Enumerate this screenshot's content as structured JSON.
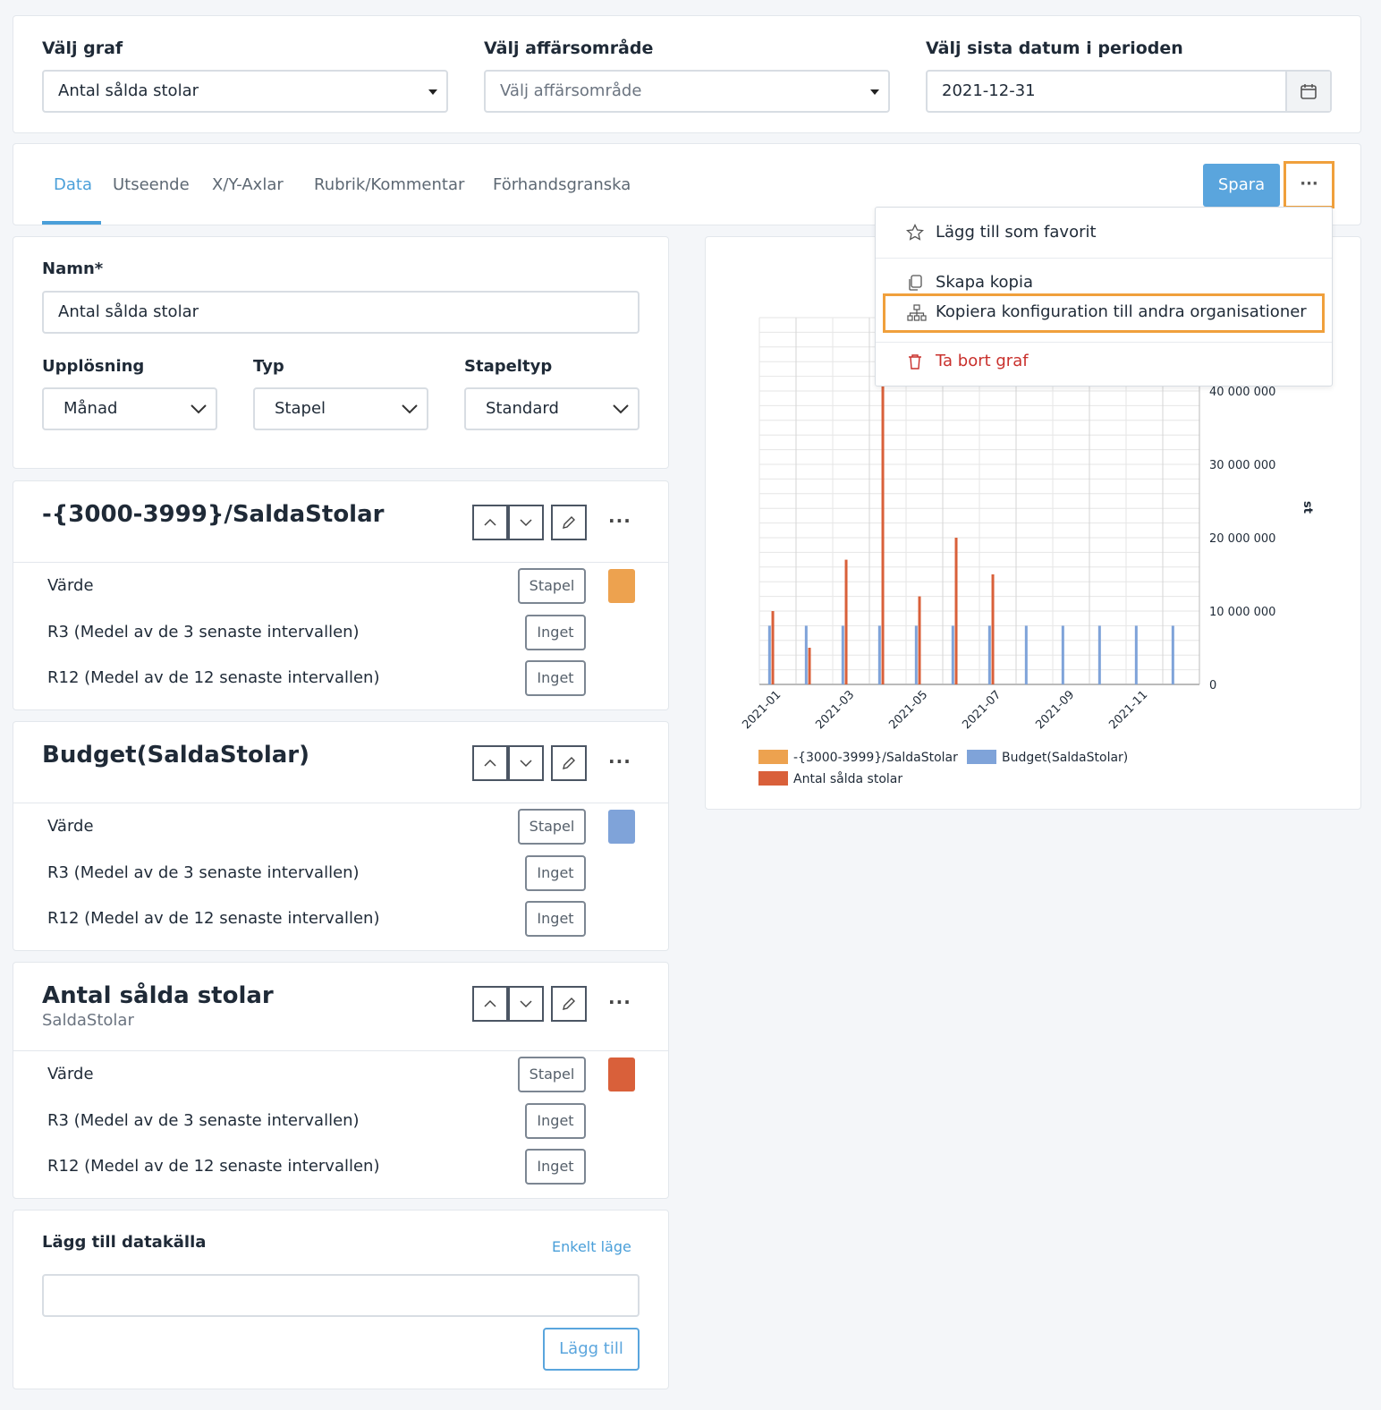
{
  "filters": {
    "graph_label": "Välj graf",
    "graph_value": "Antal sålda stolar",
    "area_label": "Välj affärsområde",
    "area_placeholder": "Välj affärsområde",
    "date_label": "Välj sista datum i perioden",
    "date_value": "2021-12-31"
  },
  "tabs": [
    "Data",
    "Utseende",
    "X/Y-Axlar",
    "Rubrik/Kommentar",
    "Förhandsgranska"
  ],
  "toolbar": {
    "save_label": "Spara",
    "more_label": "···"
  },
  "menu": {
    "favorite": "Lägg till som favorit",
    "copy": "Skapa kopia",
    "copy_config": "Kopiera konfiguration till andra organisationer",
    "delete": "Ta bort graf"
  },
  "form": {
    "name_label": "Namn*",
    "name_value": "Antal sålda stolar",
    "resolution_label": "Upplösning",
    "resolution_value": "Månad",
    "type_label": "Typ",
    "type_value": "Stapel",
    "bartype_label": "Stapeltyp",
    "bartype_value": "Standard"
  },
  "series": [
    {
      "title": "-{3000-3999}/SaldaStolar",
      "subtitle": "",
      "color": "#eda24f",
      "rows": [
        {
          "label": "Värde",
          "pill": "Stapel"
        },
        {
          "label": "R3 (Medel av de 3 senaste intervallen)",
          "pill": "Inget"
        },
        {
          "label": "R12 (Medel av de 12 senaste intervallen)",
          "pill": "Inget"
        }
      ]
    },
    {
      "title": "Budget(SaldaStolar)",
      "subtitle": "",
      "color": "#7fa3d9",
      "rows": [
        {
          "label": "Värde",
          "pill": "Stapel"
        },
        {
          "label": "R3 (Medel av de 3 senaste intervallen)",
          "pill": "Inget"
        },
        {
          "label": "R12 (Medel av de 12 senaste intervallen)",
          "pill": "Inget"
        }
      ]
    },
    {
      "title": "Antal sålda stolar",
      "subtitle": "SaldaStolar",
      "color": "#d9603a",
      "rows": [
        {
          "label": "Värde",
          "pill": "Stapel"
        },
        {
          "label": "R3 (Medel av de 3 senaste intervallen)",
          "pill": "Inget"
        },
        {
          "label": "R12 (Medel av de 12 senaste intervallen)",
          "pill": "Inget"
        }
      ]
    }
  ],
  "add_source": {
    "title": "Lägg till datakälla",
    "simple_mode": "Enkelt läge",
    "input_value": "",
    "add_button": "Lägg till"
  },
  "chart_data": {
    "type": "bar",
    "categories": [
      "2021-01",
      "2021-02",
      "2021-03",
      "2021-04",
      "2021-05",
      "2021-06",
      "2021-07",
      "2021-08",
      "2021-09",
      "2021-10",
      "2021-11",
      "2021-12"
    ],
    "x_tick_labels": [
      "2021-01",
      "2021-03",
      "2021-05",
      "2021-07",
      "2021-09",
      "2021-11"
    ],
    "y_ticks": [
      "0",
      "10 000 000",
      "20 000 000",
      "30 000 000",
      "40 000 000"
    ],
    "ylabel": "st",
    "ylim": [
      0,
      50000000
    ],
    "grid": true,
    "legend_position": "bottom",
    "series": [
      {
        "name": "-{3000-3999}/SaldaStolar",
        "color": "#eda24f",
        "values": [
          0,
          0,
          0,
          0,
          0,
          0,
          0,
          0,
          0,
          0,
          0,
          0
        ]
      },
      {
        "name": "Budget(SaldaStolar)",
        "color": "#7fa3d9",
        "values": [
          8000000,
          8000000,
          8000000,
          8000000,
          8000000,
          8000000,
          8000000,
          8000000,
          8000000,
          8000000,
          8000000,
          8000000
        ]
      },
      {
        "name": "Antal sålda stolar",
        "color": "#d9603a",
        "values": [
          10000000,
          5000000,
          17000000,
          42000000,
          12000000,
          20000000,
          15000000,
          0,
          0,
          0,
          0,
          0
        ]
      }
    ]
  }
}
